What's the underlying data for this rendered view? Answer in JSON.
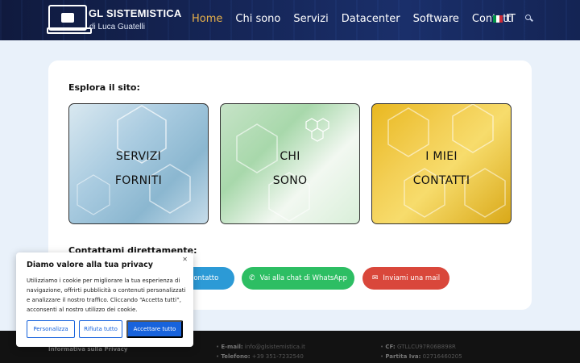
{
  "header": {
    "logo_title": "GL SISTEMISTICA",
    "logo_subtitle": "di Luca Guatelli",
    "nav": [
      "Home",
      "Chi sono",
      "Servizi",
      "Datacenter",
      "Software",
      "Contatti"
    ],
    "active_nav": "Home",
    "language": "IT",
    "flag_colors": [
      "#009246",
      "#ffffff",
      "#ce2b37"
    ],
    "accent_color": "#e8b14a"
  },
  "main": {
    "explore_label": "Esplora il sito:",
    "tiles": [
      {
        "line1": "SERVIZI",
        "line2": "FORNITI"
      },
      {
        "line1": "CHI",
        "line2": "SONO"
      },
      {
        "line1": "I MIEI",
        "line2": "CONTATTI"
      }
    ],
    "contact_label": "Contattami direttamente:",
    "buttons": {
      "call": "contatto",
      "whatsapp": "Vai alla chat di WhatsApp",
      "email": "Inviami una mail"
    }
  },
  "footer": {
    "privacy": "Informativa sulla Privacy",
    "email_label": "E-mail:",
    "email_value": "info@glsistemistica.it",
    "phone_label": "Telefono:",
    "phone_value": "+39 351-7232540",
    "cf_label": "CF:",
    "cf_value": "GTLLCU97R06B898R",
    "piva_label": "Partita Iva:",
    "piva_value": "02716460205"
  },
  "cookie": {
    "title": "Diamo valore alla tua privacy",
    "text": "Utilizziamo i cookie per migliorare la tua esperienza di navigazione, offrirti pubblicità o contenuti personalizzati e analizzare il nostro traffico. Cliccando “Accetta tutti”, acconsenti al nostro utilizzo dei cookie.",
    "customize": "Personalizza",
    "reject": "Rifiuta tutto",
    "accept": "Accettare tutto",
    "brand_color": "#1863dc"
  }
}
